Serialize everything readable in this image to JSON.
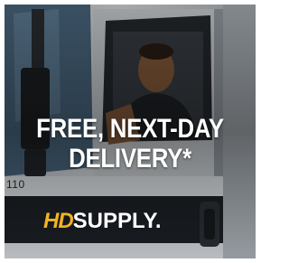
{
  "promo": {
    "headline_line1": "FREE, NEXT-DAY",
    "headline_line2": "DELIVERY*",
    "truck_number": "110",
    "logo_hd": "HD",
    "logo_supply": "SUPPLY."
  },
  "colors": {
    "headline": "#ffffff",
    "logo_accent": "#f0b323",
    "truck_body": "#e9ecef",
    "logo_band": "#1c2126"
  }
}
